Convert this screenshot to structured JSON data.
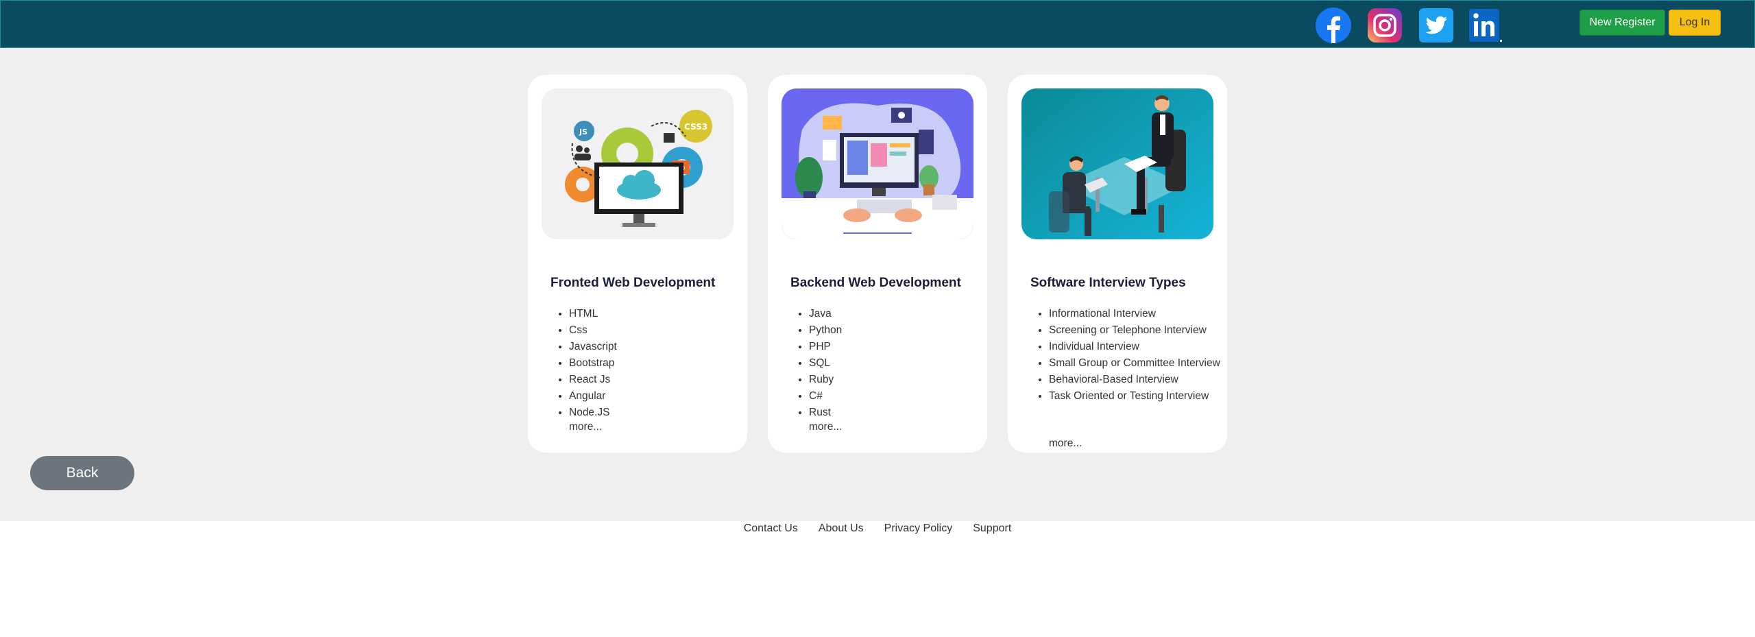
{
  "header": {
    "social_icons": [
      "facebook-icon",
      "instagram-icon",
      "twitter-icon",
      "linkedin-icon"
    ],
    "new_register_label": "New Register",
    "login_label": "Log In",
    "colors": {
      "bar": "#0b4b5f",
      "register": "#1e9e46",
      "login": "#f5bf10"
    }
  },
  "cards": [
    {
      "title": "Fronted Web Development",
      "items": [
        "HTML",
        "Css",
        "Javascript",
        "Bootstrap",
        "React Js",
        "Angular",
        "Node.JS"
      ],
      "more_label": "more..."
    },
    {
      "title": "Backend Web Development",
      "items": [
        "Java",
        "Python",
        "PHP",
        "SQL",
        "Ruby",
        "C#",
        "Rust"
      ],
      "more_label": "more..."
    },
    {
      "title": "Software Interview Types",
      "items": [
        "Informational Interview",
        "Screening or Telephone Interview",
        "Individual Interview",
        "Small Group or Committee Interview",
        "Behavioral-Based Interview",
        "Task Oriented or Testing Interview"
      ],
      "more_label": "more..."
    }
  ],
  "back_label": "Back",
  "footer": {
    "links": [
      "Contact Us",
      "About Us",
      "Privacy Policy",
      "Support"
    ]
  }
}
